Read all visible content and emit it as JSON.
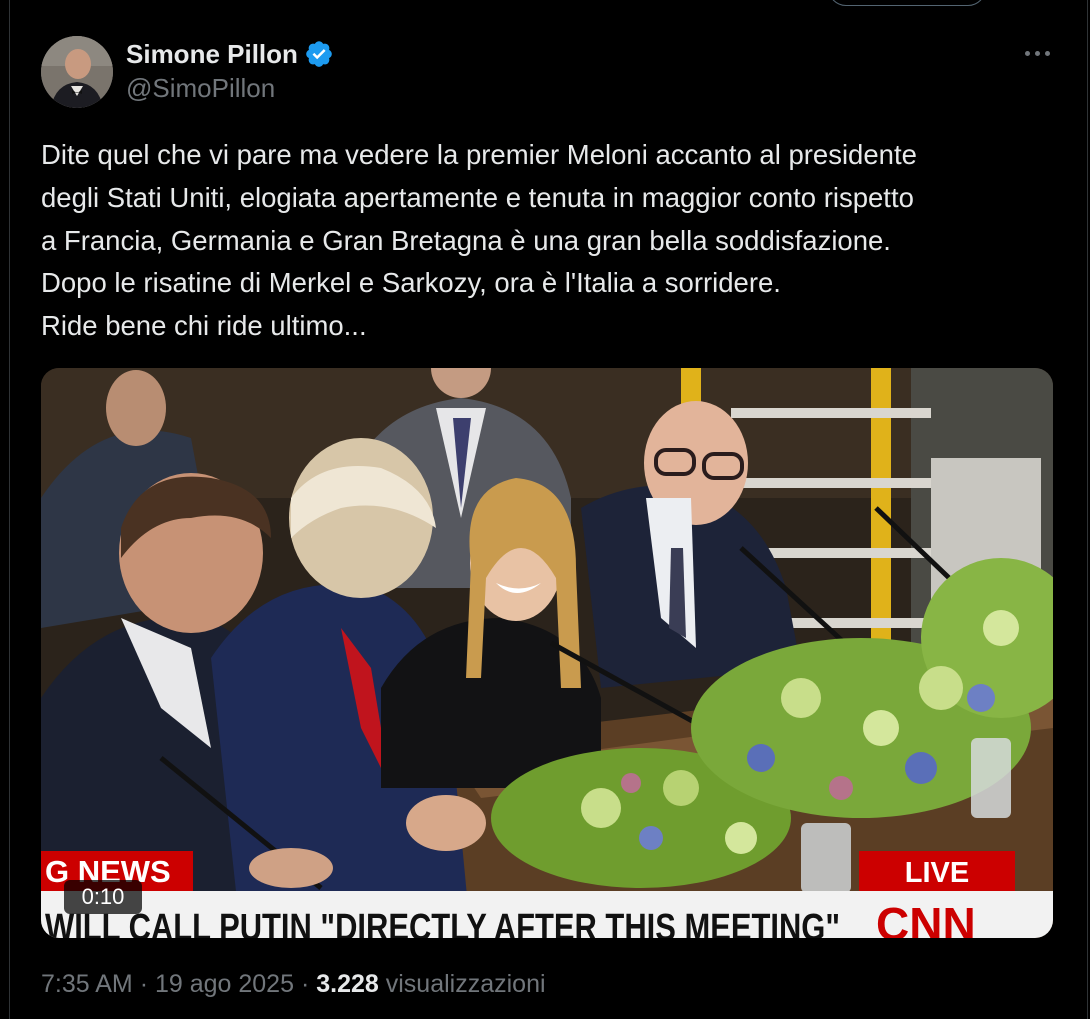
{
  "author": {
    "name": "Simone Pillon",
    "handle": "@SimoPillon",
    "verified": true
  },
  "tweet": {
    "lines": [
      "Dite quel che vi pare ma vedere la premier Meloni accanto al presidente",
      "degli Stati Uniti, elogiata apertamente e tenuta in maggior conto rispetto",
      "a Francia, Germania e Gran Bretagna è una gran bella soddisfazione.",
      "Dopo le risatine di Merkel e Sarkozy, ora è l'Italia a sorridere.",
      "Ride bene chi ride ultimo..."
    ]
  },
  "media": {
    "type": "video",
    "duration": "0:10",
    "chyron_left": "G NEWS",
    "chyron_live": "LIVE",
    "ticker": "WILL CALL PUTIN \"DIRECTLY AFTER THIS MEETING\"",
    "network_logo": "CNN"
  },
  "meta": {
    "time": "7:35 AM",
    "separator": "·",
    "date": "19 ago 2025",
    "views_count": "3.228",
    "views_label": "visualizzazioni"
  },
  "colors": {
    "background": "#000000",
    "text": "#e7e9ea",
    "secondary": "#71767b",
    "verified": "#1d9bf0",
    "cnn_red": "#cc0000"
  },
  "icons": {
    "verified": "verified-badge-icon",
    "more": "more-horizontal-icon"
  }
}
